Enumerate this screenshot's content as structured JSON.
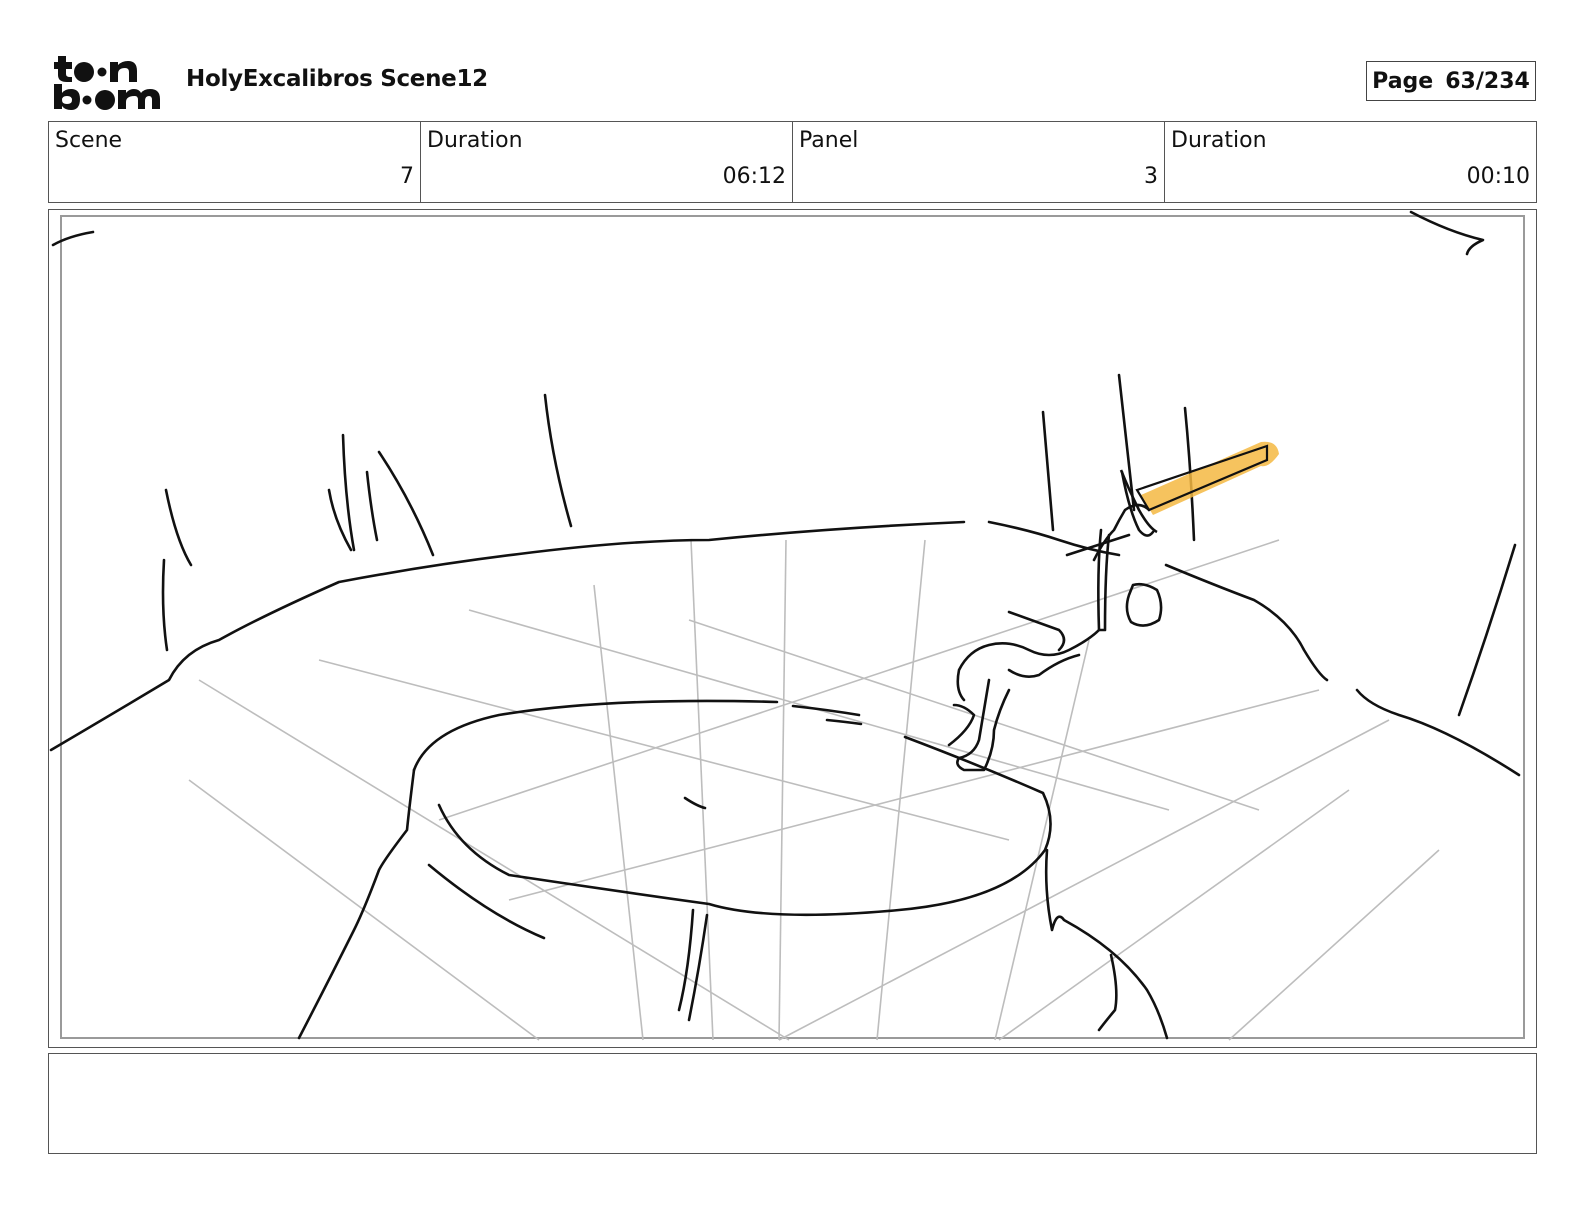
{
  "header": {
    "logo_text": "toon boom",
    "title": "HolyExcalibros Scene12",
    "page_label": "Page",
    "page_number": "63/234"
  },
  "info": {
    "scene_label": "Scene",
    "scene_value": "7",
    "scene_duration_label": "Duration",
    "scene_duration_value": "06:12",
    "panel_label": "Panel",
    "panel_value": "3",
    "panel_duration_label": "Duration",
    "panel_duration_value": "00:10"
  },
  "colors": {
    "sword_highlight": "#f5b942",
    "ink": "#111111",
    "guide_lines": "#bdbdbd"
  },
  "notes": {
    "text": ""
  }
}
